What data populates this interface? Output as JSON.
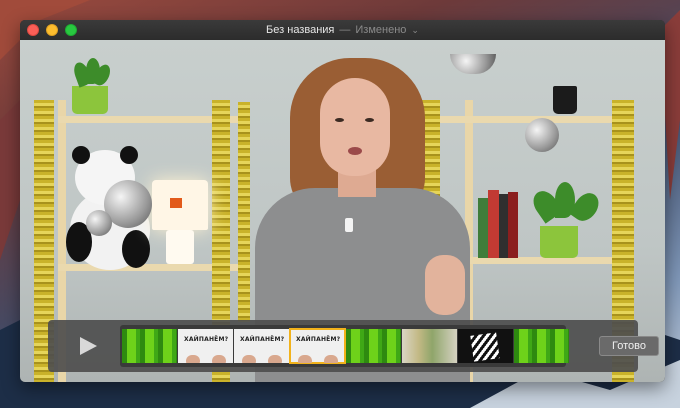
{
  "window": {
    "title": "Без названия",
    "separator": "—",
    "status": "Изменено",
    "status_chevron": "⌄"
  },
  "trim_controls": {
    "play_icon": "play-icon",
    "frames": [
      {
        "kind": "green-screen"
      },
      {
        "kind": "hype-card",
        "text": "ХАЙПАНЁМ?"
      },
      {
        "kind": "hype-card",
        "text": "ХАЙПАНЁМ?"
      },
      {
        "kind": "hype-card",
        "text": "ХАЙПАНЁМ?",
        "selected": true
      },
      {
        "kind": "green-screen"
      },
      {
        "kind": "shelf-room"
      },
      {
        "kind": "zebra-card"
      },
      {
        "kind": "green-screen"
      }
    ],
    "done_label": "Готово"
  },
  "colors": {
    "selection_outline": "#f2b21b",
    "close": "#fc5f57",
    "minimize": "#fdbd2e",
    "maximize": "#28c840"
  }
}
